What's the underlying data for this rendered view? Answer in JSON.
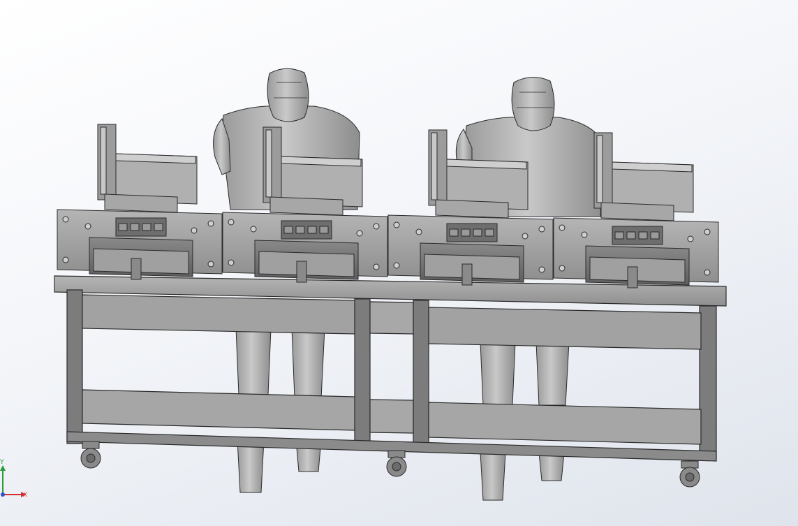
{
  "viewport": {
    "background_top": "#ffffff",
    "background_bottom": "#dfe4ec"
  },
  "model": {
    "body_color": "#b9b9b9",
    "dark_color": "#6f6f6f",
    "edge_color": "#2b2b2b",
    "operator_count": 2,
    "workstation_count": 4
  },
  "triad": {
    "x_label": "X",
    "y_label": "Y",
    "x_color": "#d03030",
    "y_color": "#2a9a3a",
    "z_color": "#3050d0"
  }
}
